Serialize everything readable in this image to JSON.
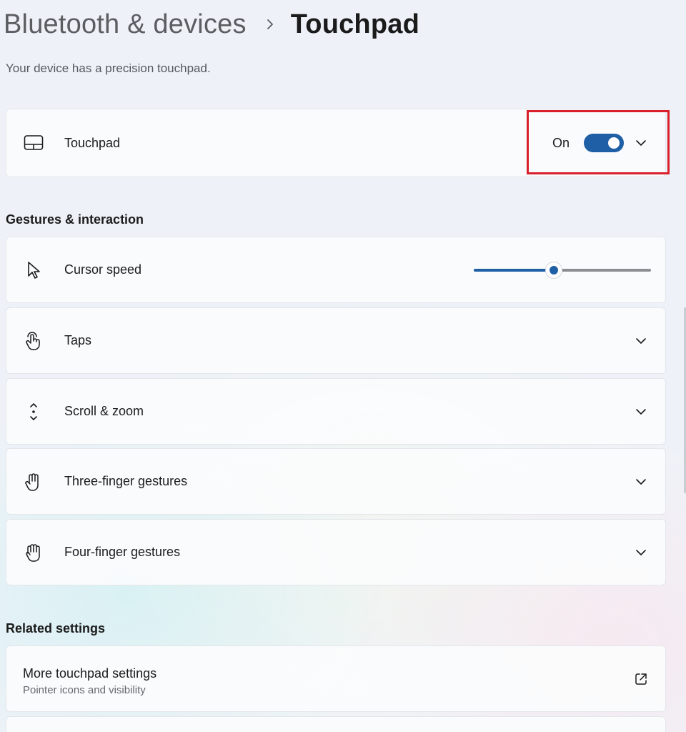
{
  "breadcrumb": {
    "parent": "Bluetooth & devices",
    "separator_icon": "chevron-right-icon",
    "current": "Touchpad"
  },
  "subtitle": "Your device has a precision touchpad.",
  "touchpad_card": {
    "icon": "touchpad-icon",
    "label": "Touchpad",
    "toggle_state_text": "On",
    "toggle_on": true,
    "expand_icon": "chevron-down-icon"
  },
  "gestures_section": {
    "heading": "Gestures & interaction",
    "cursor_speed": {
      "icon": "cursor-icon",
      "label": "Cursor speed",
      "slider_value_fraction": 0.45
    },
    "items": [
      {
        "label": "Taps",
        "icon": "tap-icon"
      },
      {
        "label": "Scroll & zoom",
        "icon": "scroll-icon"
      },
      {
        "label": "Three-finger gestures",
        "icon": "three-finger-icon"
      },
      {
        "label": "Four-finger gestures",
        "icon": "four-finger-icon"
      }
    ]
  },
  "related_settings": {
    "heading": "Related settings",
    "items": [
      {
        "title": "More touchpad settings",
        "subtitle": "Pointer icons and visibility",
        "icon": "external-link-icon"
      }
    ]
  },
  "colors": {
    "accent": "#1f5fa6",
    "highlight": "#d9202b",
    "background": "#eef2f8"
  }
}
